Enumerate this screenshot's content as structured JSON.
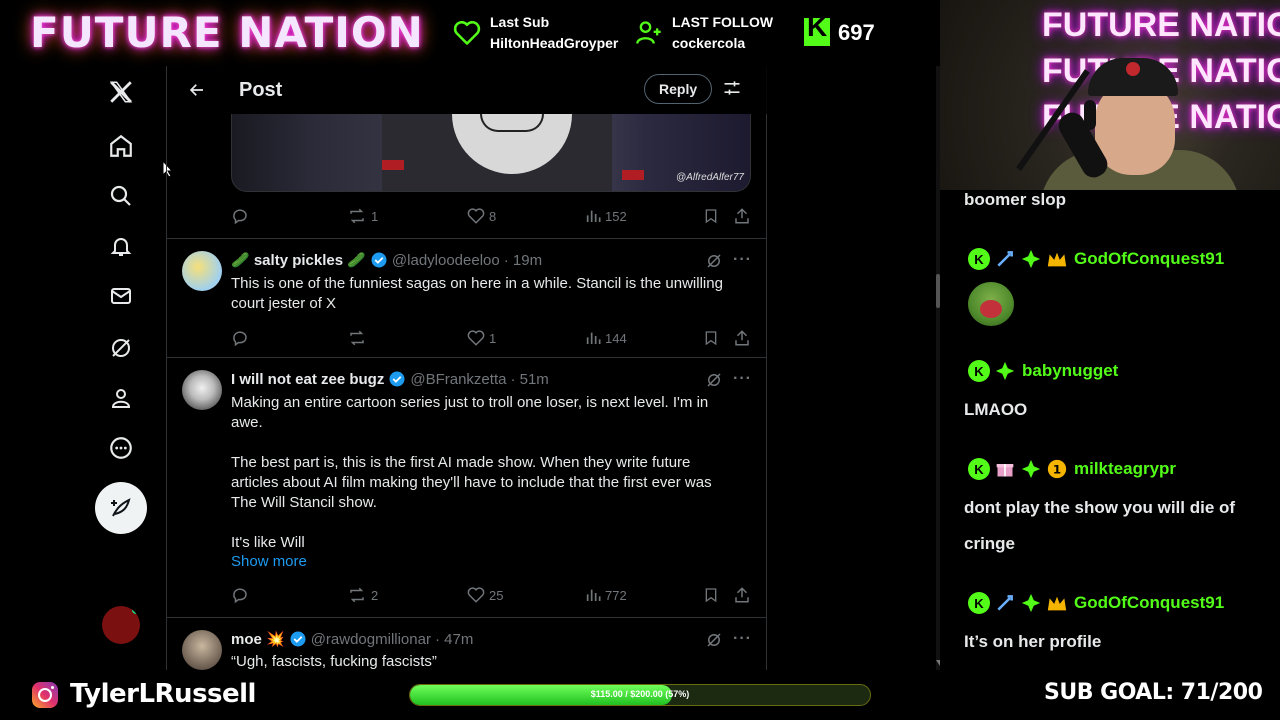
{
  "overlay": {
    "brand": "FUTURE NATION",
    "last_sub_label": "Last Sub",
    "last_sub_name": "HiltonHeadGroyper",
    "last_follow_label": "LAST FOLLOW",
    "last_follow_name": "cockercola",
    "kick_count": "697",
    "instagram_handle": "TylerLRussell",
    "goal_bar_text": "$115.00 / $200.00 (57%)",
    "goal_progress_fraction": 0.57,
    "sub_goal": "SUB GOAL: 71/200",
    "webcam_neon": [
      "FUTURE NATION",
      "FUTURE NATION",
      "FUTURE NATION"
    ]
  },
  "x": {
    "header": {
      "title": "Post",
      "reply_label": "Reply"
    },
    "nav_icons": [
      "x-logo-icon",
      "home-icon",
      "search-icon",
      "bell-icon",
      "mail-icon",
      "grok-icon",
      "profile-icon",
      "more-icon"
    ],
    "media_watermark": "@AlfredAlfer77",
    "main_post_stats": {
      "reposts": "1",
      "likes": "8",
      "views": "152"
    },
    "replies": [
      {
        "name": "🥒 salty pickles 🥒",
        "handle": "@ladyloodeeloo",
        "time": "· 19m",
        "text": "This is one of the funniest sagas on here in a while. Stancil is the unwilling court jester of X",
        "replies": "",
        "reposts": "",
        "likes": "1",
        "views": "144"
      },
      {
        "name": "I will not eat zee bugz",
        "handle": "@BFrankzetta",
        "time": "· 51m",
        "text": "Making an entire cartoon series just to troll one loser, is next level. I'm in awe.\n\nThe best part is, this is the first AI made show. When they write future articles about AI film making they'll have to include that the first ever was The Will Stancil show.\n\nIt's like Will",
        "show_more": "Show more",
        "replies": "",
        "reposts": "2",
        "likes": "25",
        "views": "772"
      },
      {
        "name": "moe 💥",
        "handle": "@rawdogmillionar",
        "time": "· 47m",
        "text": "“Ugh, fascists, fucking fascists”"
      }
    ]
  },
  "chat": {
    "messages": [
      {
        "text": "boomer slop"
      },
      {
        "user": "GodOfConquest91",
        "user_color": "#53fc18",
        "emote": "frog-scream-emote"
      },
      {
        "user": "babynugget",
        "user_color": "#53fc18",
        "text": "LMAOO"
      },
      {
        "user": "milkteagrypr",
        "user_color": "#53fc18",
        "text": "dont play the show you will die of cringe"
      },
      {
        "user": "GodOfConquest91",
        "user_color": "#53fc18",
        "text": "It’s on her profile"
      }
    ]
  },
  "colors": {
    "kick_green": "#53fc18",
    "x_blue": "#1d9bf0",
    "verified_blue": "#1d9bf0",
    "muted": "#71767b"
  }
}
